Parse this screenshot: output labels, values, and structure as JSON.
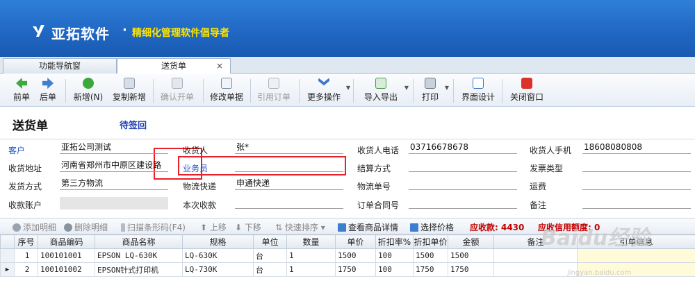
{
  "header": {
    "brand": "亚拓软件",
    "dot": "·",
    "slogan": "精细化管理软件倡导者",
    "brand_color": "#ffffff",
    "slogan_color": "#ffe600"
  },
  "tabs": [
    {
      "label": "功能导航窗"
    },
    {
      "label": "送货单",
      "close": "×"
    }
  ],
  "toolbar": {
    "prev": "前单",
    "next": "后单",
    "new": "新增(N)",
    "copy_new": "复制新增",
    "confirm": "确认开单",
    "edit": "修改单据",
    "ref_order": "引用订单",
    "more": "更多操作",
    "import_export": "导入导出",
    "print": "打印",
    "ui_design": "界面设计",
    "close_window": "关闭窗口"
  },
  "page": {
    "title": "送货单",
    "status": "待签回"
  },
  "form": {
    "customer_label": "客户",
    "customer_value": "亚拓公司测试",
    "receiver_label": "收货人",
    "receiver_value": "张*",
    "receiver_phone_label": "收货人电话",
    "receiver_phone_value": "03716678678",
    "receiver_mobile_label": "收货人手机",
    "receiver_mobile_value": "18608080808",
    "address_label": "收货地址",
    "address_value": "河南省郑州市中原区建设路",
    "salesman_label": "业务员",
    "salesman_value": "",
    "settlement_label": "结算方式",
    "invoice_label": "发票类型",
    "ship_method_label": "发货方式",
    "ship_method_value": "第三方物流",
    "logistics_label": "物流快递",
    "logistics_value": "申通快递",
    "logistics_no_label": "物流单号",
    "freight_label": "运费",
    "account_label": "收款账户",
    "this_receipt_label": "本次收款",
    "contract_label": "订单合同号",
    "remark_label": "备注"
  },
  "gridbar": {
    "add_detail": "添加明细",
    "delete_detail": "删除明细",
    "scan": "扫描条形码(F4)",
    "move_up": "上移",
    "move_down": "下移",
    "quick_sort": "快速排序",
    "view_detail": "查看商品详情",
    "select_price": "选择价格",
    "receivable": "应收款: 4430",
    "credit": "应收信用额度: 0"
  },
  "table": {
    "columns": [
      "序号",
      "商品编码",
      "商品名称",
      "规格",
      "单位",
      "数量",
      "单价",
      "折扣率%",
      "折扣单价",
      "金额",
      "备注",
      "引单信息"
    ],
    "rows": [
      [
        "1",
        "100101001",
        "EPSON LQ-630K",
        "LQ-630K",
        "台",
        "1",
        "1500",
        "100",
        "1500",
        "1500",
        "",
        ""
      ],
      [
        "2",
        "100101002",
        "EPSON针式打印机",
        "LQ-730K",
        "台",
        "1",
        "1750",
        "100",
        "1750",
        "1750",
        "",
        ""
      ]
    ]
  },
  "watermark": {
    "text": "Baidu经验",
    "url": "jingyan.baidu.com"
  }
}
